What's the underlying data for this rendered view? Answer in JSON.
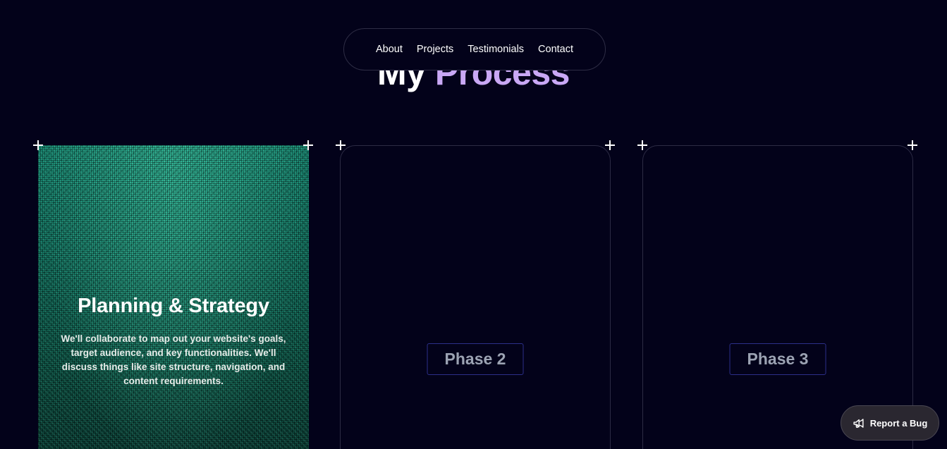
{
  "nav": {
    "items": [
      {
        "label": "About"
      },
      {
        "label": "Projects"
      },
      {
        "label": "Testimonials"
      },
      {
        "label": "Contact"
      }
    ]
  },
  "heading": {
    "part1": "My",
    "part2": "Process"
  },
  "cards": [
    {
      "title": "Planning & Strategy",
      "description": "We'll collaborate to map out your website's goals, target audience, and key functionalities. We'll discuss things like site structure, navigation, and content requirements."
    },
    {
      "badge": "Phase 2"
    },
    {
      "badge": "Phase 3"
    }
  ],
  "report_bug": {
    "label": "Report a Bug",
    "icon": "megaphone-icon"
  },
  "colors": {
    "background": "#03021a",
    "accent": "#c9a8f5",
    "card_active": "#137562"
  }
}
